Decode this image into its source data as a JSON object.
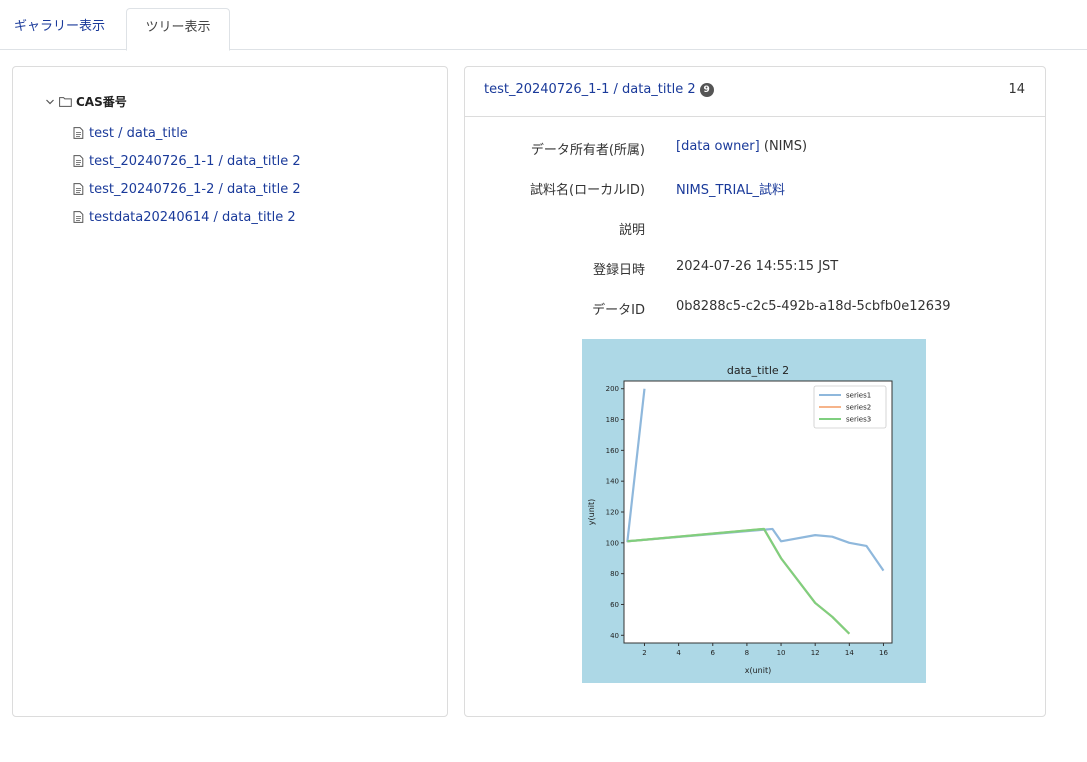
{
  "tabs": {
    "gallery": "ギャラリー表示",
    "tree": "ツリー表示"
  },
  "tree": {
    "root_label": "CAS番号",
    "items": [
      "test / data_title",
      "test_20240726_1-1 / data_title 2",
      "test_20240726_1-2 / data_title 2",
      "testdata20240614 / data_title 2"
    ]
  },
  "detail": {
    "title": "test_20240726_1-1 / data_title 2",
    "badge": "9",
    "count": "14",
    "owner_label": "データ所有者(所属)",
    "owner_link": "[data owner]",
    "owner_affiliation": " (NIMS)",
    "sample_label": "試料名(ローカルID)",
    "sample_value": "NIMS_TRIAL_試料",
    "description_label": "説明",
    "description_value": "",
    "registered_label": "登録日時",
    "registered_value": "2024-07-26 14:55:15 JST",
    "dataid_label": "データID",
    "dataid_value": "0b8288c5-c2c5-492b-a18d-5cbfb0e12639"
  },
  "colors": {
    "link": "#1a3a9a",
    "chart_bg": "#add8e6"
  },
  "chart_data": {
    "type": "line",
    "title": "data_title 2",
    "xlabel": "x(unit)",
    "ylabel": "y(unit)",
    "xlim": [
      0.8,
      16.5
    ],
    "ylim": [
      35,
      205
    ],
    "xticks": [
      2,
      4,
      6,
      8,
      10,
      12,
      14,
      16
    ],
    "yticks": [
      40,
      60,
      80,
      100,
      120,
      140,
      160,
      180,
      200
    ],
    "legend": "top-right",
    "grid": false,
    "series": [
      {
        "name": "series1",
        "color": "#8fb8dc",
        "x": [
          2,
          1,
          9.5,
          10,
          12,
          13,
          14,
          15,
          16
        ],
        "y": [
          200,
          101,
          109,
          101,
          105,
          104,
          100,
          98,
          82
        ]
      },
      {
        "name": "series2",
        "color": "#f6b48a",
        "x": [
          1,
          9,
          10,
          12,
          13,
          14
        ],
        "y": [
          101,
          109,
          90,
          61,
          52,
          41
        ]
      },
      {
        "name": "series3",
        "color": "#7fcf7f",
        "x": [
          1,
          9,
          10,
          12,
          13,
          14
        ],
        "y": [
          101,
          109,
          90,
          61,
          52,
          41
        ]
      }
    ]
  }
}
